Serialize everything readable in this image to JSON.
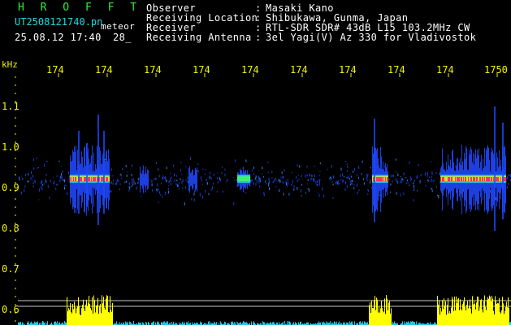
{
  "app": {
    "title": "H R O F F T",
    "filename": "UT2508121740.pn",
    "mode": "meteor",
    "datetime": "25.08.12 17:40",
    "count": "28_"
  },
  "info": {
    "labels": [
      "Observer",
      "Receiving Location",
      "Receiver",
      "Receiving Antenna"
    ],
    "colons": [
      ":",
      ":",
      ":",
      ":"
    ],
    "values": [
      "Masaki Kano",
      "Shibukawa, Gunma, Japan",
      "RTL-SDR SDR# 43dB L15 103.2MHz CW",
      "3el Yagi(V) Az 330 for Vladivostok"
    ]
  },
  "axis": {
    "y_unit": "kHz",
    "y_ticks": [
      "1.1",
      "1.0",
      "0.9",
      "0.8",
      "0.7",
      "0.6"
    ],
    "x_ticks": [
      "174",
      "174",
      "174",
      "174",
      "174",
      "174",
      "174",
      "174",
      "174",
      "1750"
    ]
  },
  "colors": {
    "text": "#ffffff",
    "labels": "#f4f400",
    "title": "#33ee33",
    "filename": "#20d8e8",
    "signal_hot": "#ff3366",
    "histogram": "#ffff00"
  }
}
